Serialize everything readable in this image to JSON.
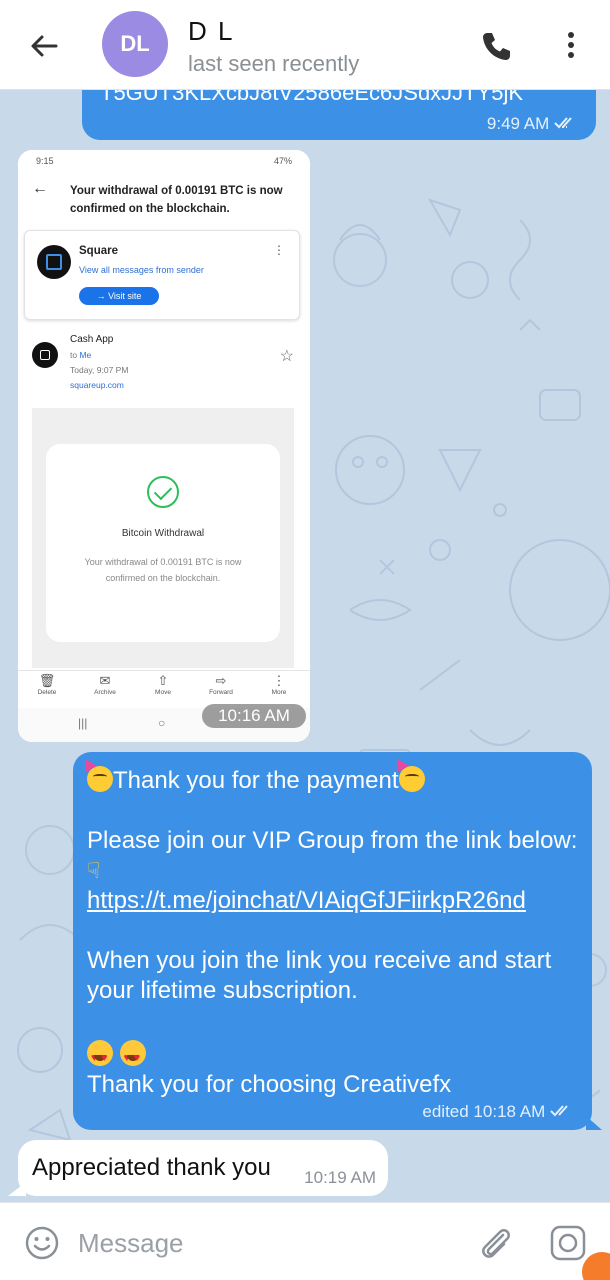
{
  "header": {
    "avatar_initials": "DL",
    "name": "D L",
    "status": "last seen recently",
    "back_icon": "arrow-left-icon",
    "call_icon": "phone-icon",
    "more_icon": "more-vertical-icon"
  },
  "messages": {
    "m1": {
      "text_fragment": "T5GUT3KLXcbJ8tV2586eEc6JSdxJJTY5jK",
      "time": "9:49 AM"
    },
    "photo": {
      "time": "10:16 AM",
      "status_time": "9:15",
      "status_right": "47%",
      "email_title": "Your withdrawal of 0.00191 BTC is now confirmed on the blockchain.",
      "sender": "Square",
      "view_all": "View all messages from sender",
      "visit_site": "Visit site",
      "from": "Cash App",
      "to_prefix": "to",
      "to": "Me",
      "date": "Today, 9:07 PM",
      "domain": "squareup.com",
      "receipt_title": "Bitcoin Withdrawal",
      "receipt_text": "Your withdrawal of 0.00191 BTC is now confirmed on the blockchain.",
      "toolbar": [
        "Delete",
        "Archive",
        "Move",
        "Forward",
        "More"
      ]
    },
    "m3": {
      "line1": "Thank you for the payment",
      "line2": "Please join our VIP Group from the link below:",
      "link": "https://t.me/joinchat/VIAiqGfJFiirkpR26nd",
      "line3": "When you join the link you receive and start your lifetime subscription.",
      "line4": "Thank you for choosing Creativefx",
      "meta": "edited 10:18 AM"
    },
    "m4": {
      "text": "Appreciated thank you",
      "time": "10:19 AM"
    }
  },
  "input": {
    "placeholder": "Message",
    "emoji_icon": "smiley-icon",
    "attach_icon": "paperclip-icon",
    "camera_icon": "camera-icon"
  },
  "colors": {
    "outgoing_bubble": "#3c91e6",
    "incoming_bubble": "#ffffff",
    "chat_background": "#c8d9ea",
    "avatar": "#9c8be2"
  }
}
